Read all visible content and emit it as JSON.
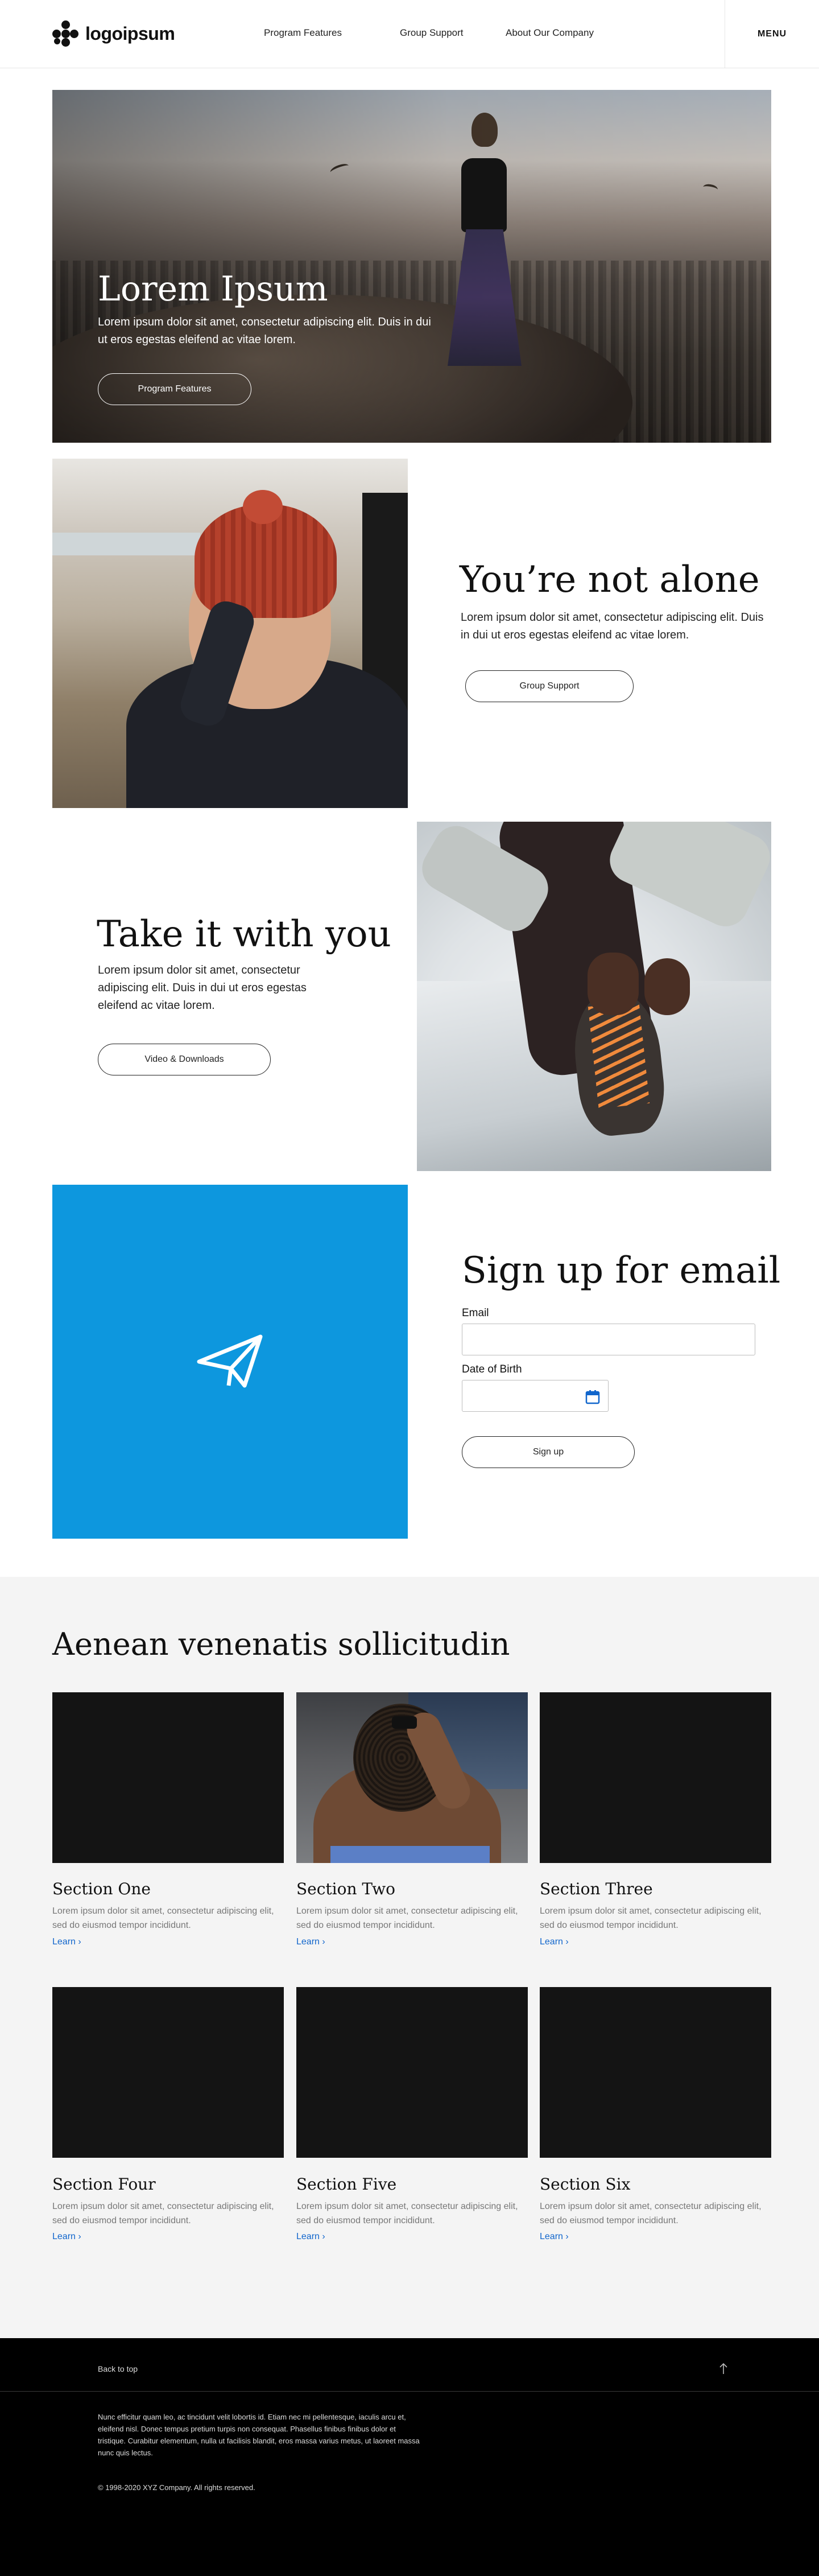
{
  "header": {
    "logo_text": "logoipsum",
    "nav": [
      "Program Features",
      "Group Support",
      "About Our Company"
    ],
    "menu_label": "MENU"
  },
  "hero": {
    "title": "Lorem Ipsum",
    "text": "Lorem ipsum dolor sit amet, consectetur adipiscing elit. Duis in dui ut eros egestas eleifend ac vitae lorem.",
    "button": "Program Features"
  },
  "feature1": {
    "title": "You’re not alone",
    "text": "Lorem ipsum dolor sit amet, consectetur adipiscing elit. Duis in dui ut eros egestas eleifend ac vitae lorem.",
    "button": "Group Support"
  },
  "feature2": {
    "title": "Take it with you",
    "text": "Lorem ipsum dolor sit amet, consectetur adipiscing elit. Duis in dui ut eros egestas eleifend ac vitae lorem.",
    "button": "Video & Downloads"
  },
  "signup": {
    "title": "Sign up for email",
    "email_label": "Email",
    "email_value": "",
    "dob_label": "Date of Birth",
    "dob_value": "",
    "button": "Sign up",
    "icon": "paper-plane-icon",
    "box_color": "#0d97de"
  },
  "cards": {
    "title": "Aenean venenatis sollicitudin",
    "items": [
      {
        "title": "Section One",
        "text": "Lorem ipsum dolor sit amet, consectetur adipiscing elit, sed do eiusmod tempor incididunt.",
        "link": "Learn ›"
      },
      {
        "title": "Section Two",
        "text": "Lorem ipsum dolor sit amet, consectetur adipiscing elit, sed do eiusmod tempor incididunt.",
        "link": "Learn ›"
      },
      {
        "title": "Section Three",
        "text": "Lorem ipsum dolor sit amet, consectetur adipiscing elit, sed do eiusmod tempor incididunt.",
        "link": "Learn ›"
      },
      {
        "title": "Section Four",
        "text": "Lorem ipsum dolor sit amet, consectetur adipiscing elit, sed do eiusmod tempor incididunt.",
        "link": "Learn ›"
      },
      {
        "title": "Section Five",
        "text": "Lorem ipsum dolor sit amet, consectetur adipiscing elit, sed do eiusmod tempor incididunt.",
        "link": "Learn ›"
      },
      {
        "title": "Section Six",
        "text": "Lorem ipsum dolor sit amet, consectetur adipiscing elit, sed do eiusmod tempor incididunt.",
        "link": "Learn ›"
      }
    ]
  },
  "footer": {
    "back_to_top": "Back to top",
    "text": "Nunc efficitur quam leo, ac tincidunt velit lobortis id. Etiam nec mi pellentesque, iaculis arcu et, eleifend nisl. Donec tempus pretium turpis non consequat. Phasellus finibus finibus dolor et tristique. Curabitur elementum, nulla ut facilisis blandit, eros massa varius metus, ut laoreet massa nunc quis lectus.",
    "copyright": "© 1998-2020 XYZ Company. All rights reserved.",
    "icon": "arrow-up-icon"
  }
}
